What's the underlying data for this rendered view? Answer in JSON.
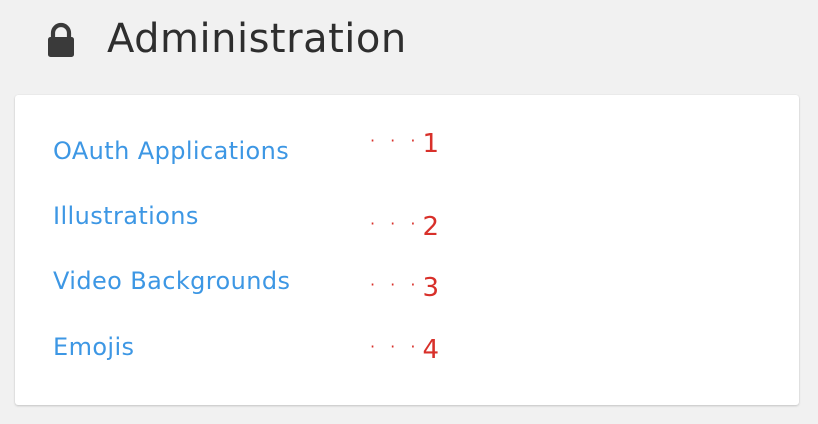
{
  "header": {
    "title": "Administration",
    "icon": "lock-icon"
  },
  "colors": {
    "background": "#f1f1f1",
    "card": "#ffffff",
    "link": "#3d97e4",
    "title": "#2e2e2e",
    "annotation": "#d8302a"
  },
  "links": [
    {
      "label": "OAuth Applications",
      "annotation": "1"
    },
    {
      "label": "Illustrations",
      "annotation": "2"
    },
    {
      "label": "Video Backgrounds",
      "annotation": "3"
    },
    {
      "label": "Emojis",
      "annotation": "4"
    }
  ],
  "annotation_dots": "· · ·"
}
